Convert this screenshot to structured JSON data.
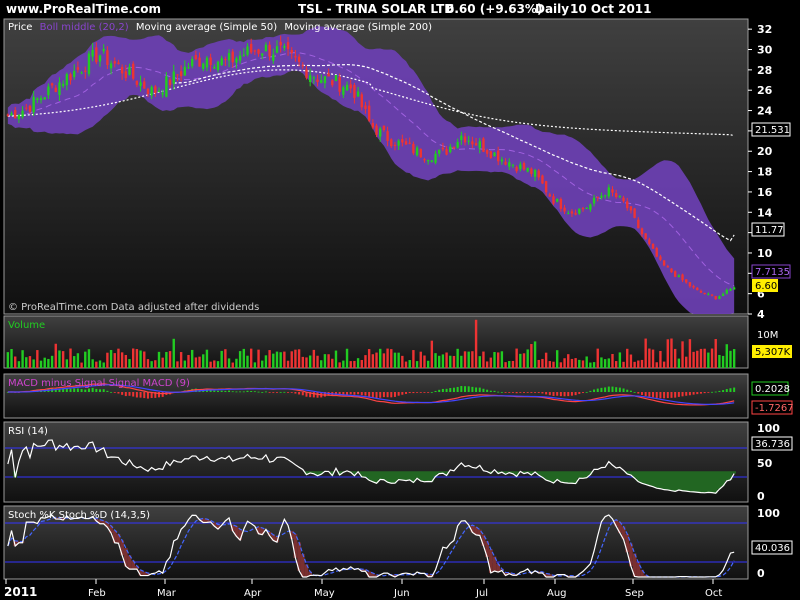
{
  "header": {
    "site": "www.ProRealTime.com",
    "symbol": "TSL - TRINA SOLAR LTD.",
    "last": "6.60 (+9.63%)",
    "period": "Daily",
    "date": "10 Oct 2011"
  },
  "price_panel": {
    "legend": {
      "price": "Price",
      "boll": "Boll middle (20,2)",
      "ma50": "Moving average (Simple 50)",
      "ma200": "Moving average (Simple 200)"
    },
    "watermark": "© ProRealTime.com  Data adjusted after dividends",
    "axis_labels": [
      "32",
      "30",
      "28",
      "26",
      "24",
      "22",
      "20",
      "18",
      "16",
      "14",
      "12",
      "10",
      "8",
      "6",
      "4"
    ],
    "tags": {
      "ma200": "21.531",
      "ma50": "11.77",
      "boll": "7.7135",
      "price": "6.60"
    }
  },
  "volume_panel": {
    "title": "Volume",
    "axis_label": "10M",
    "tag": "5,307K"
  },
  "macd_panel": {
    "title": "MACD minus Signal Signal MACD (9)",
    "tag_macd": "0.2028",
    "tag_signal": "-1.7267"
  },
  "rsi_panel": {
    "title": "RSI (14)",
    "axis_labels": [
      "100",
      "50",
      "0"
    ],
    "tag": "36.736"
  },
  "stoch_panel": {
    "title": "Stoch %K Stoch %D (14,3,5)",
    "axis_labels": [
      "100",
      "50",
      "0"
    ],
    "tag": "40.036"
  },
  "x_axis": {
    "labels": [
      "2011",
      "Feb",
      "Mar",
      "Apr",
      "May",
      "Jun",
      "Jul",
      "Aug",
      "Sep",
      "Oct"
    ]
  },
  "colors": {
    "up": "#22cc22",
    "down": "#ee3333",
    "boll_band": "#6a3fb0",
    "ma_line": "#ffffff",
    "signal": "#2222dd",
    "rsi_ref": "#3333ff"
  },
  "chart_data": {
    "type": "candlestick",
    "title": "TSL - TRINA SOLAR LTD.",
    "period": "Daily",
    "x_range": [
      "Jan 2011",
      "10 Oct 2011"
    ],
    "price_ylim": [
      4,
      32
    ],
    "weekly_close": [
      23.5,
      24.2,
      25.6,
      27.0,
      28.2,
      29.6,
      28.4,
      27.1,
      25.8,
      27.0,
      28.5,
      29.3,
      28.7,
      29.6,
      30.1,
      29.8,
      28.6,
      27.3,
      26.8,
      26.2,
      22.5,
      21.2,
      20.4,
      19.6,
      19.8,
      21.6,
      20.6,
      19.5,
      18.6,
      17.8,
      15.3,
      14.0,
      14.6,
      16.2,
      14.8,
      11.6,
      8.9,
      7.5,
      6.2,
      5.6,
      6.6
    ],
    "ma50_end": 11.77,
    "ma200_end": 21.531,
    "boll_mid_end": 7.7135,
    "last_price": 6.6,
    "volume_ylim": [
      0,
      14
    ],
    "volume_last_k": 5307,
    "macd_last": 0.2028,
    "signal_last": -1.7267,
    "rsi_last": 36.736,
    "stoch_k_last": 40.036
  }
}
